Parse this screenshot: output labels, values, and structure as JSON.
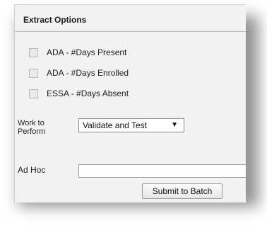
{
  "panel": {
    "title": "Extract Options"
  },
  "checkboxes": [
    {
      "label": "ADA - #Days Present",
      "checked": false
    },
    {
      "label": "ADA - #Days Enrolled",
      "checked": false
    },
    {
      "label": "ESSA - #Days Absent",
      "checked": false
    }
  ],
  "work_to_perform": {
    "label_line1": "Work to",
    "label_line2": "Perform",
    "selected": "Validate and Test",
    "arrow_glyph": "▼"
  },
  "ad_hoc": {
    "label": "Ad Hoc",
    "value": ""
  },
  "submit": {
    "label": "Submit to Batch"
  }
}
